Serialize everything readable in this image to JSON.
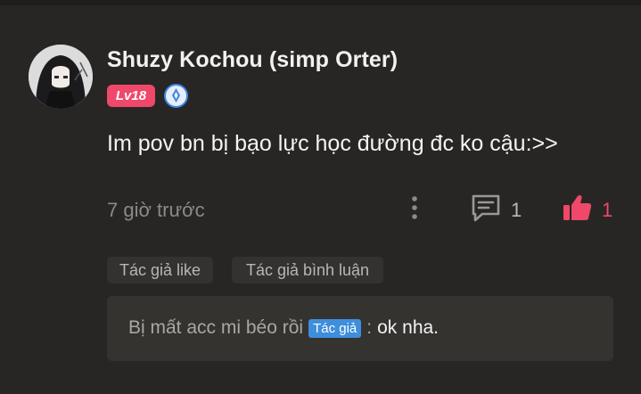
{
  "comment": {
    "username": "Shuzy Kochou (simp Orter)",
    "level": "Lv18",
    "text": "Im pov bn bị bạo lực học đường đc ko cậu:>>",
    "timestamp": "7 giờ trước",
    "reply_count": "1",
    "like_count": "1"
  },
  "tags": {
    "author_liked": "Tác giả like",
    "author_replied": "Tác giả bình luận"
  },
  "reply": {
    "author": "Bị mất acc mi béo rồi",
    "author_badge": "Tác giả",
    "separator": ":",
    "message": "ok nha."
  },
  "icons": {
    "avatar": "avatar",
    "verify": "verified-blue-icon",
    "more": "more-vertical-icon",
    "reply": "comment-icon",
    "like": "thumbs-up-icon"
  },
  "colors": {
    "background": "#282624",
    "accent_pink": "#f0486a",
    "author_badge_blue": "#3e8edc",
    "panel": "#353330"
  }
}
